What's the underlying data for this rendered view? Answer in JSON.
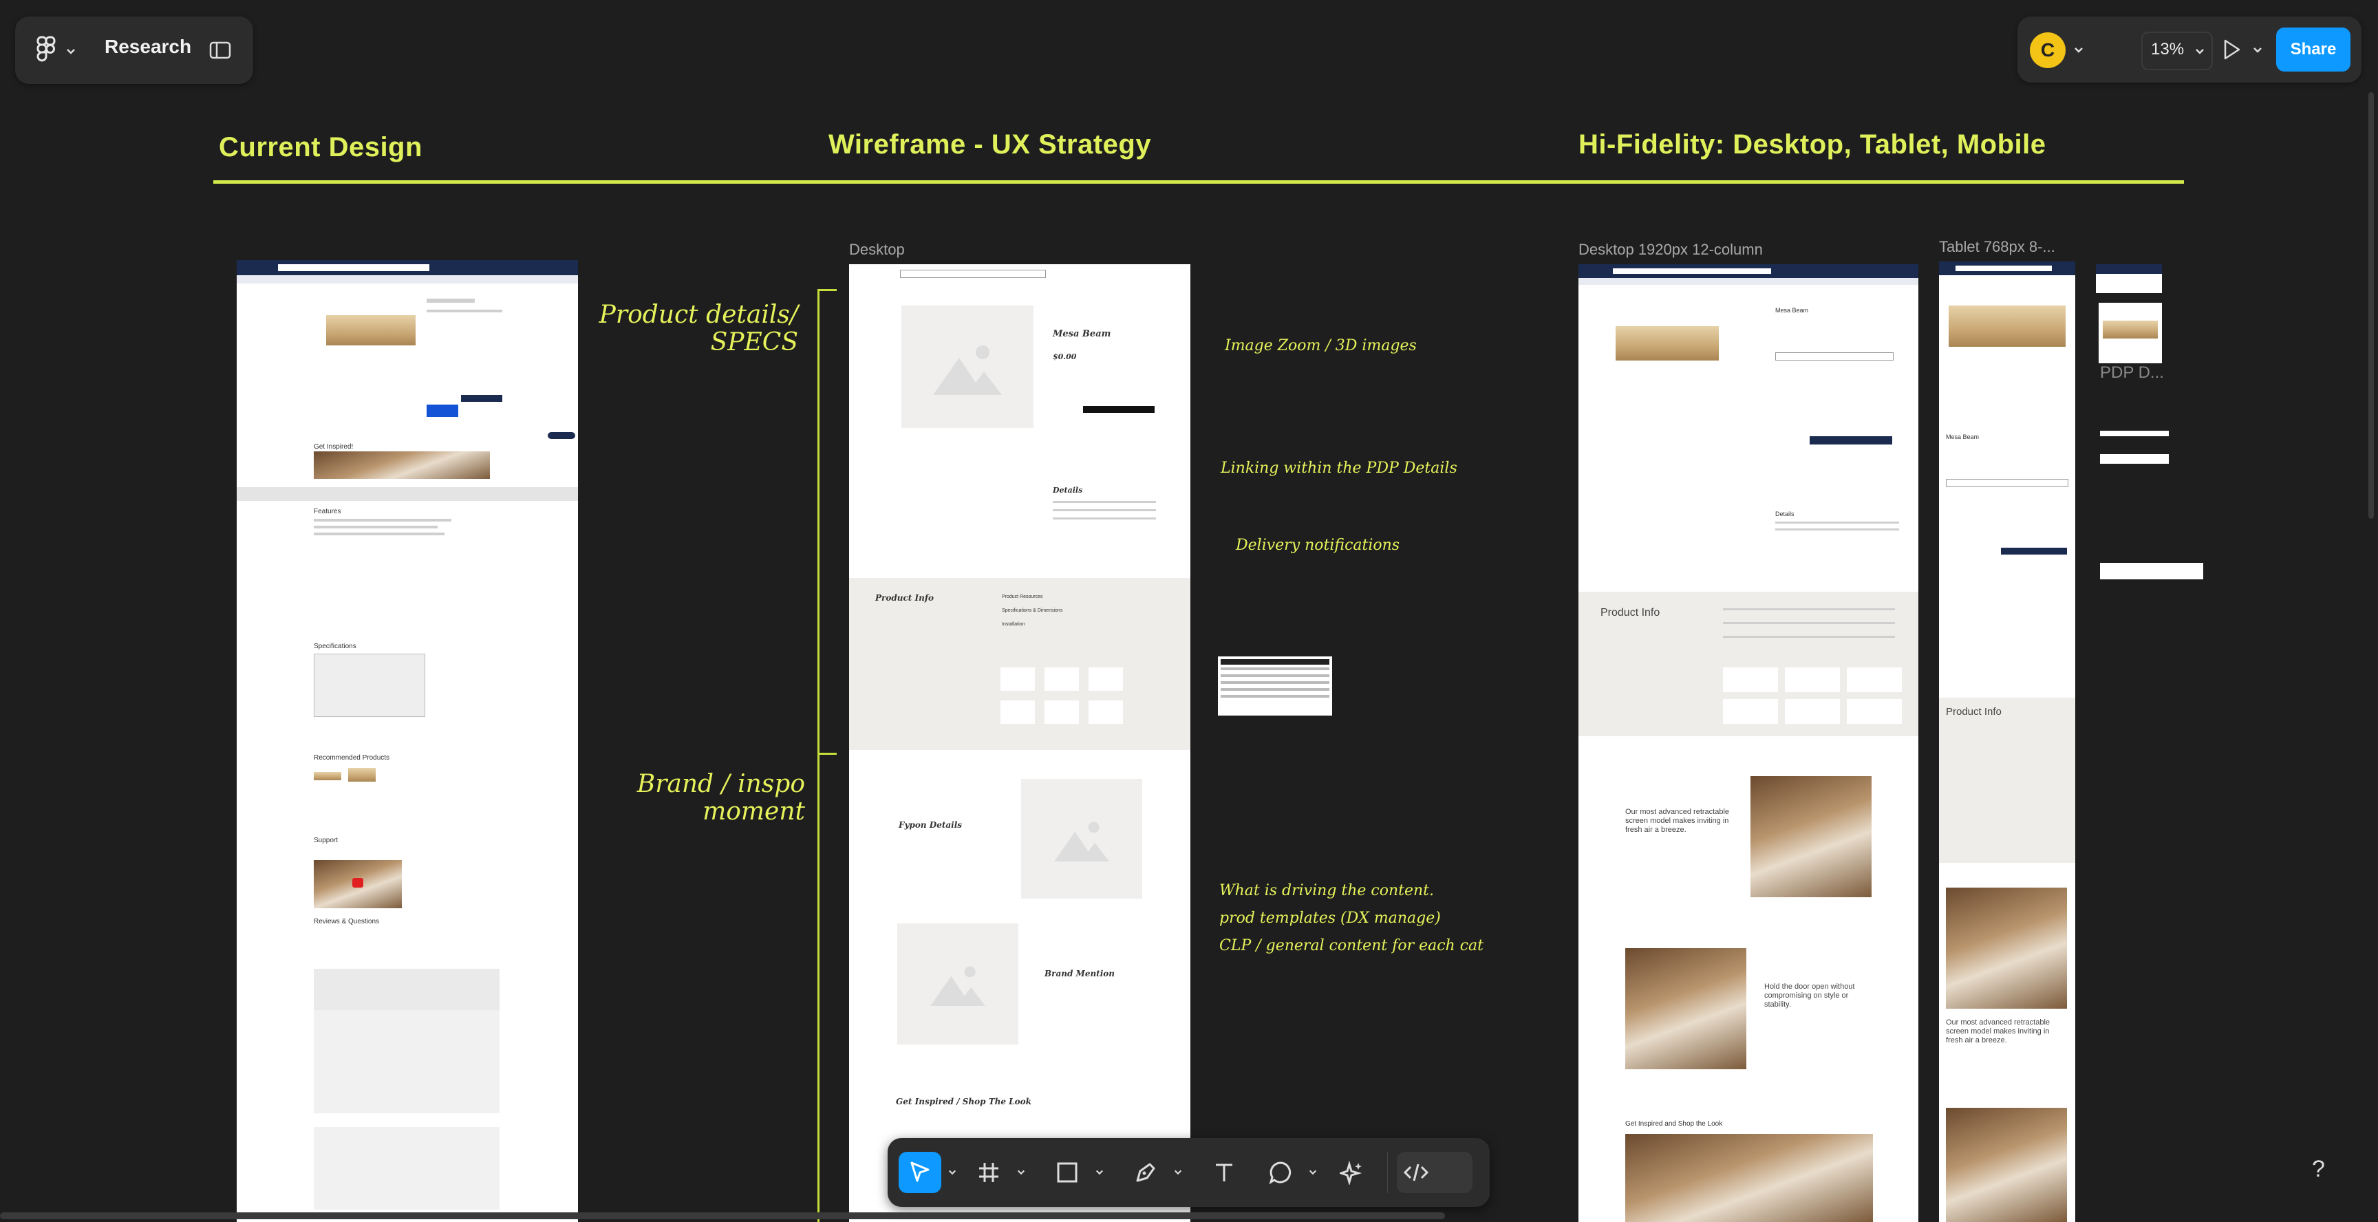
{
  "toolbar_top": {
    "file_name": "Research",
    "zoom": "13%",
    "user_initial": "C",
    "share_label": "Share"
  },
  "sections": {
    "current": "Current Design",
    "wireframe": "Wireframe - UX Strategy",
    "hifi": "Hi-Fidelity: Desktop, Tablet, Mobile"
  },
  "frame_labels": {
    "desktop": "Desktop",
    "desktop_1920": "Desktop 1920px 12-column",
    "tablet": "Tablet 768px 8-...",
    "pdp": "PDP D..."
  },
  "annotations": {
    "product_details": "Product details/ SPECS",
    "brand": "Brand / inspo moment",
    "zoom": "Image Zoom / 3D images",
    "linking": "Linking within the PDP Details",
    "delivery": "Delivery notifications",
    "driving": "What is driving the content.",
    "templates": "prod templates (DX manage)",
    "clp": "CLP / general content for each cat"
  },
  "wireframe": {
    "product_name": "Mesa Beam",
    "price": "$0.00",
    "details": "Details",
    "product_info": "Product Info",
    "accordion": [
      "Product Resources",
      "Specifications & Dimensions",
      "Installation"
    ],
    "fypon_details": "Fypon Details",
    "brand_mention": "Brand Mention",
    "get_inspired": "Get Inspired / Shop The Look"
  },
  "current_design": {
    "get_inspired": "Get Inspired!",
    "features": "Features",
    "specifications": "Specifications",
    "recommended": "Recommended Products",
    "support": "Support",
    "reviews": "Reviews & Questions"
  },
  "hifi": {
    "product_info": "Product Info",
    "product_info_tablet": "Product Info",
    "retractable": "Our most advanced retractable screen model makes inviting in fresh air a breeze.",
    "hold_open": "Hold the door open without compromising on style or stability.",
    "get_inspired": "Get Inspired and Shop the Look",
    "details": "Details",
    "product_name": "Mesa Beam"
  },
  "bottom_toolbar": {
    "tools": [
      "move-tool",
      "frame-tool",
      "shape-tool",
      "pen-tool",
      "text-tool",
      "comment-tool",
      "actions-tool",
      "dev-mode-toggle"
    ]
  },
  "help": "?"
}
